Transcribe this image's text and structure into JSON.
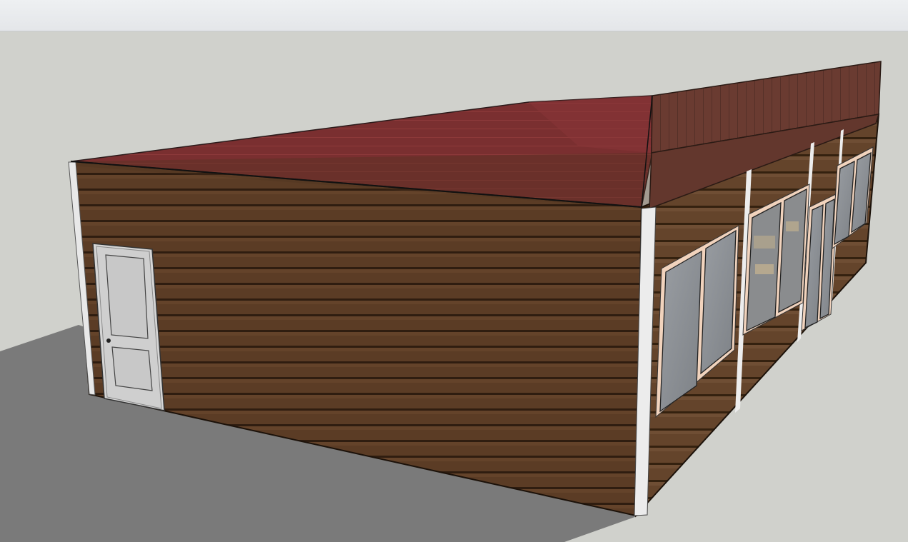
{
  "app": {
    "viewport_label": "",
    "toolbar_label": ""
  },
  "scene": {
    "sky_color": "#d0d1cc",
    "ground_color": "#7b7b7b",
    "roof_color": "#7a2f30",
    "fascia_color": "#6b3e33",
    "siding_color": "#5a3b24",
    "trim_color": "#e9e9e9",
    "door_color": "#d6d6d6",
    "window_frame_color": "#f0d4bf",
    "glass_color": "#8e9195"
  }
}
